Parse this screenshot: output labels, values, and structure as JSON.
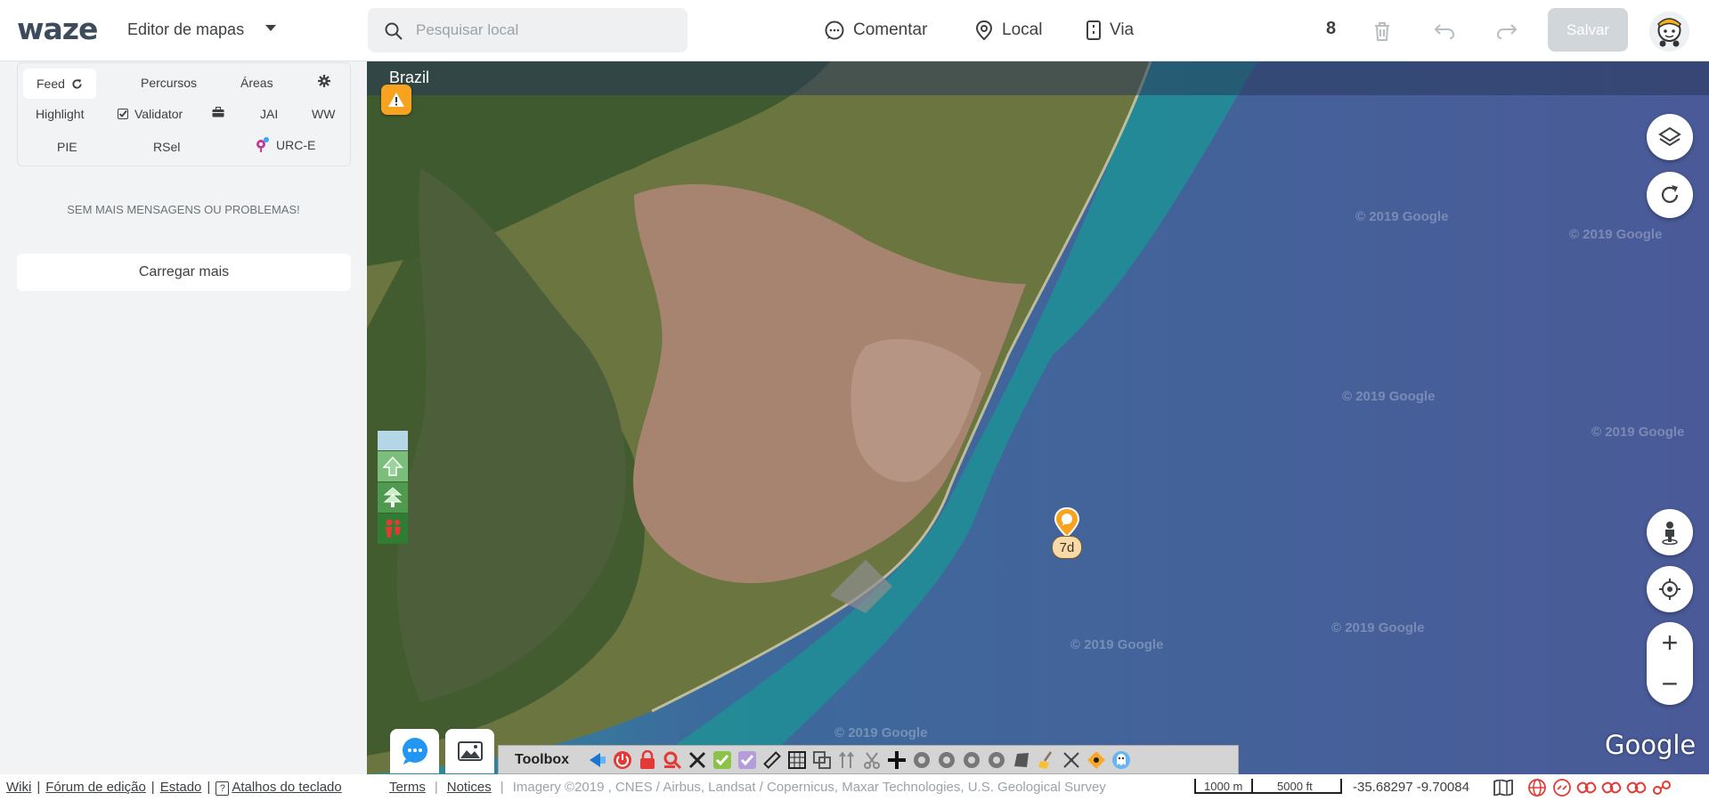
{
  "header": {
    "logo": "waze",
    "app_title": "Editor de mapas",
    "search_placeholder": "Pesquisar local",
    "comment_label": "Comentar",
    "place_label": "Local",
    "road_label": "Via",
    "edit_count": "8",
    "save_label": "Salvar",
    "icons": [
      "chat-bubble-icon",
      "map-pin-icon",
      "road-icon",
      "trash-icon",
      "undo-icon",
      "redo-icon"
    ]
  },
  "sidebar": {
    "tabs_row1": [
      "Feed",
      "Percursos",
      "Áreas"
    ],
    "tabs_row2": [
      "Highlight",
      "Validator",
      "JAI",
      "WW"
    ],
    "tabs_row3": [
      "PIE",
      "RSel",
      "URC-E"
    ],
    "empty_message": "SEM MAIS MENSAGENS OU PROBLEMAS!",
    "load_more_label": "Carregar mais"
  },
  "map": {
    "country": "Brazil",
    "watermark": "© 2019 Google",
    "pin_label": "7d",
    "google_label": "Google",
    "toolbox_label": "Toolbox",
    "colors": {
      "sea": "#4a5d97",
      "coast": "#2a8a9a",
      "land": "#5f6f3c",
      "urban": "#b08a72"
    }
  },
  "footer": {
    "wiki": "Wiki",
    "forum": "Fórum de edição",
    "status": "Estado",
    "shortcuts": "Atalhos do teclado",
    "shortcuts_key": "?",
    "terms": "Terms",
    "notices": "Notices",
    "imagery": "Imagery ©2019 , CNES / Airbus, Landsat / Copernicus, Maxar Technologies, U.S. Geological Survey",
    "scale_metric": "1000 m",
    "scale_imperial": "5000 ft",
    "coords": "-35.68297 -9.70084"
  }
}
